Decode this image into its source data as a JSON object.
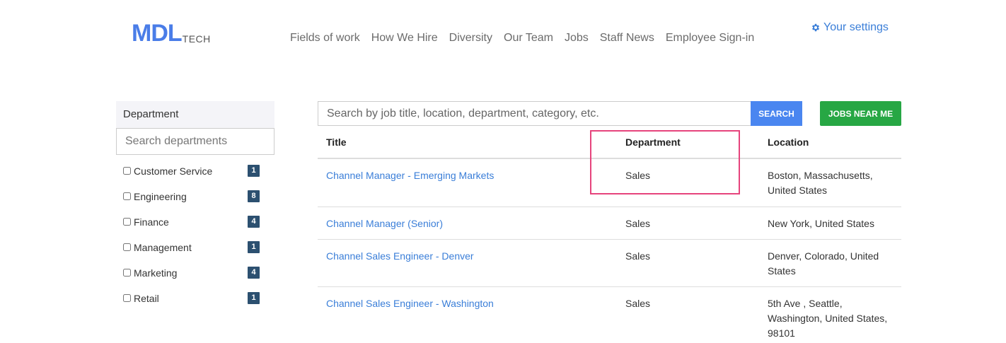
{
  "header": {
    "logo_main": "MDL",
    "logo_sub": "TECH",
    "nav": [
      {
        "label": "Fields of work"
      },
      {
        "label": "How We Hire"
      },
      {
        "label": "Diversity"
      },
      {
        "label": "Our Team"
      },
      {
        "label": "Jobs"
      },
      {
        "label": "Staff News"
      },
      {
        "label": "Employee Sign-in"
      }
    ],
    "settings_label": "Your settings",
    "settings_icon": "gear-icon"
  },
  "sidebar": {
    "title": "Department",
    "search_placeholder": "Search departments",
    "items": [
      {
        "label": "Customer Service",
        "count": "1"
      },
      {
        "label": "Engineering",
        "count": "8"
      },
      {
        "label": "Finance",
        "count": "4"
      },
      {
        "label": "Management",
        "count": "1"
      },
      {
        "label": "Marketing",
        "count": "4"
      },
      {
        "label": "Retail",
        "count": "1"
      }
    ]
  },
  "search": {
    "placeholder": "Search by job title, location, department, category, etc.",
    "search_button": "SEARCH",
    "near_button": "JOBS NEAR ME"
  },
  "table": {
    "headers": {
      "title": "Title",
      "department": "Department",
      "location": "Location"
    },
    "rows": [
      {
        "title": "Channel Manager - Emerging Markets",
        "department": "Sales",
        "location": "Boston, Massachusetts, United States"
      },
      {
        "title": "Channel Manager (Senior)",
        "department": "Sales",
        "location": "New York, United States"
      },
      {
        "title": "Channel Sales Engineer - Denver",
        "department": "Sales",
        "location": "Denver, Colorado, United States"
      },
      {
        "title": "Channel Sales Engineer - Washington",
        "department": "Sales",
        "location": "5th Ave , Seattle, Washington, United States, 98101"
      }
    ]
  },
  "colors": {
    "brand": "#4a7de8",
    "link": "#3a7ed8",
    "search_button": "#4a86f0",
    "near_button": "#27a744",
    "badge": "#2c5070",
    "highlight": "#e6447c"
  }
}
